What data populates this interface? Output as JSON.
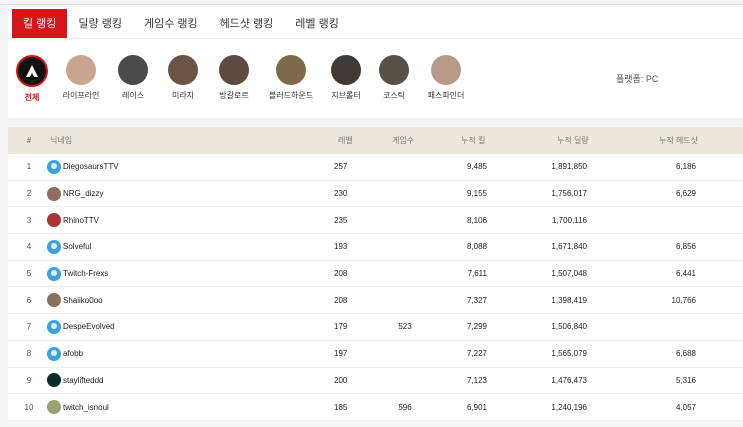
{
  "tabs": [
    "킬 랭킹",
    "딜량 랭킹",
    "게임수 랭킹",
    "헤드샷 랭킹",
    "레벨 랭킹"
  ],
  "legends": [
    "전체",
    "라이프라인",
    "레이스",
    "미라지",
    "방갈로르",
    "블러드하운드",
    "지브롤터",
    "코스틱",
    "패스파인더"
  ],
  "platform": "플랫폼: PC",
  "columns": {
    "rank": "#",
    "name": "닉네임",
    "level": "레벨",
    "games": "게임수",
    "kills": "누적 킬",
    "damage": "누적 딜량",
    "headshots": "누적 헤드샷"
  },
  "rows": [
    {
      "rank": "1",
      "name": "DiegosaursTTV",
      "level": "257",
      "games": "",
      "kills": "9,485",
      "damage": "1,891,850",
      "headshots": "6,186",
      "avatar": "blue"
    },
    {
      "rank": "2",
      "name": "NRG_dizzy",
      "level": "230",
      "games": "",
      "kills": "9,155",
      "damage": "1,756,017",
      "headshots": "6,629",
      "avatar": "photo"
    },
    {
      "rank": "3",
      "name": "RhinoTTV",
      "level": "235",
      "games": "",
      "kills": "8,106",
      "damage": "1,700,116",
      "headshots": "",
      "avatar": "red"
    },
    {
      "rank": "4",
      "name": "Solveful",
      "level": "193",
      "games": "",
      "kills": "8,088",
      "damage": "1,671,840",
      "headshots": "6,856",
      "avatar": "blue"
    },
    {
      "rank": "5",
      "name": "Twitch-Frexs",
      "level": "208",
      "games": "",
      "kills": "7,611",
      "damage": "1,507,048",
      "headshots": "6,441",
      "avatar": "blue"
    },
    {
      "rank": "6",
      "name": "Shaiiko0oo",
      "level": "208",
      "games": "",
      "kills": "7,327",
      "damage": "1,398,419",
      "headshots": "10,766",
      "avatar": "photo"
    },
    {
      "rank": "7",
      "name": "DespeEvolved",
      "level": "179",
      "games": "523",
      "kills": "7,299",
      "damage": "1,506,840",
      "headshots": "",
      "avatar": "blue"
    },
    {
      "rank": "8",
      "name": "afobb",
      "level": "197",
      "games": "",
      "kills": "7,227",
      "damage": "1,565,079",
      "headshots": "6,688",
      "avatar": "blue"
    },
    {
      "rank": "9",
      "name": "staylifteddd",
      "level": "200",
      "games": "",
      "kills": "7,123",
      "damage": "1,476,473",
      "headshots": "5,316",
      "avatar": "tree"
    },
    {
      "rank": "10",
      "name": "twitch_isnoul",
      "level": "185",
      "games": "596",
      "kills": "6,901",
      "damage": "1,240,196",
      "headshots": "4,057",
      "avatar": "avatarimg"
    }
  ],
  "colors": {
    "accent": "#d8151a",
    "header_bg": "#ede8de"
  }
}
